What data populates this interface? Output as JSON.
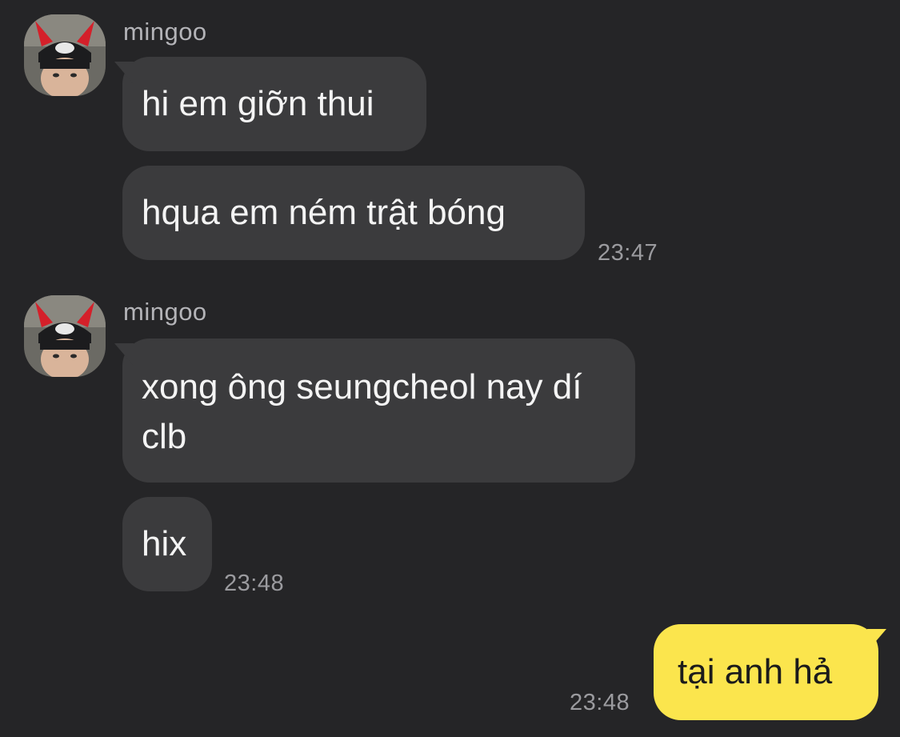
{
  "messages": [
    {
      "sender": "mingoo",
      "avatar_icon": "profile-photo-devil-horns",
      "bubbles": [
        "hi em giỡn thui",
        "hqua em ném trật bóng"
      ],
      "time": "23:47"
    },
    {
      "sender": "mingoo",
      "avatar_icon": "profile-photo-devil-horns",
      "bubbles": [
        "xong ông seungcheol nay dí clb",
        "hix"
      ],
      "time": "23:48"
    },
    {
      "sender": "me",
      "bubbles": [
        "tại anh hả"
      ],
      "time": "23:48"
    }
  ],
  "colors": {
    "background": "#252527",
    "incoming_bubble": "#3b3b3d",
    "outgoing_bubble": "#fbe54d"
  }
}
